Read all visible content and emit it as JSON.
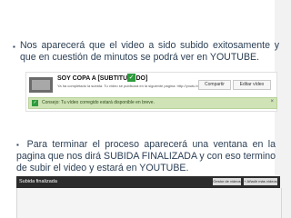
{
  "slide": {
    "bullet1": {
      "mark": "▪",
      "text": "Nos aparecerá que el video a sido subido exitosamente y que en cuestión de minutos se podrá ver en YOUTUBE."
    },
    "youtube_panel": {
      "video_title": "SOY COPA A [SUBTITULADO]",
      "video_subtitle": "Ya ha completado la subida. Tu vídeo se publicará en la siguiente página: http://youtu.be/Y3vu4BvcBOQ",
      "share_button": "Compartir",
      "edit_button": "Editar vídeo",
      "success_message": "Consejo: Tu vídeo corregido estará disponible en breve.",
      "close_glyph": "×"
    },
    "bullet2": {
      "mark": "▪",
      "text": "Para terminar el proceso aparecerá una ventana en la pagina que nos dirá SUBIDA FINALIZADA y con eso termino de subir el video y estará en YOUTUBE."
    },
    "upload_bar": {
      "title": "Subida finalizada",
      "button1": "Gestor de vídeos",
      "button2": "+ Añadir más vídeos"
    }
  }
}
